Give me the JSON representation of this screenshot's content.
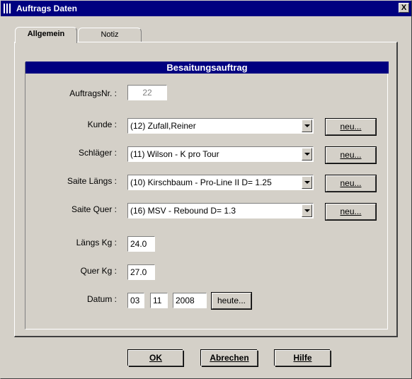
{
  "window": {
    "title": "Auftrags Daten",
    "close_label": "X"
  },
  "tabs": [
    {
      "label": "Allgemein"
    },
    {
      "label": "Notiz"
    }
  ],
  "group": {
    "title": "Besaitungsauftrag"
  },
  "form": {
    "auftragsnr": {
      "label": "AuftragsNr. :",
      "value": "22"
    },
    "kunde": {
      "label": "Kunde :",
      "value": "(12) Zufall,Reiner"
    },
    "schlaeger": {
      "label": "Schläger :",
      "value": "(11) Wilson - K pro Tour"
    },
    "saite_laengs": {
      "label": "Saite Längs :",
      "value": "(10) Kirschbaum - Pro-Line II D= 1.25"
    },
    "saite_quer": {
      "label": "Saite Quer :",
      "value": "(16) MSV - Rebound D= 1.3"
    },
    "laengs_kg": {
      "label": "Längs Kg :",
      "value": "24.0"
    },
    "quer_kg": {
      "label": "Quer Kg :",
      "value": "27.0"
    },
    "datum": {
      "label": "Datum :",
      "day": "03",
      "month": "11",
      "year": "2008",
      "today_label": "heute..."
    },
    "new_label": "neu..."
  },
  "footer": {
    "ok": "OK",
    "cancel": "Abrechen",
    "help": "Hilfe"
  },
  "icons": {
    "combo": "chevron-down-icon",
    "app": "app-icon"
  }
}
